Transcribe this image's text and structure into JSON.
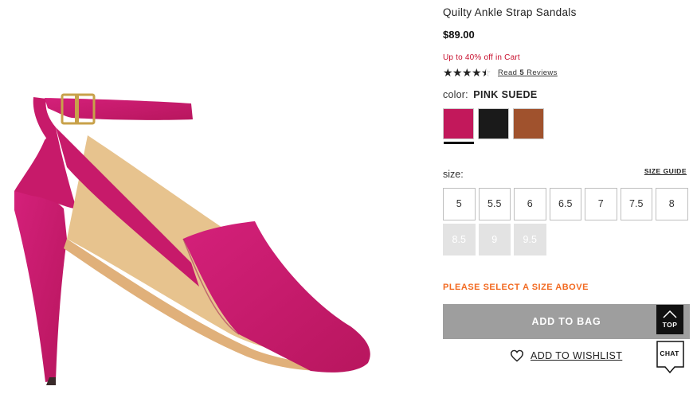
{
  "product": {
    "title": "Quilty Ankle Strap Sandals",
    "price": "$89.00",
    "promo": "Up to 40% off in Cart",
    "rating": 4.5,
    "reviews_prefix": "Read",
    "reviews_count": "5",
    "reviews_suffix": "Reviews",
    "image_alt": "pink suede ankle strap sandal"
  },
  "color": {
    "label": "color:",
    "selected": "PINK SUEDE",
    "swatches": [
      {
        "name": "pink-suede",
        "hex": "#c2185b",
        "selected": true
      },
      {
        "name": "black-suede",
        "hex": "#1a1a1a",
        "selected": false
      },
      {
        "name": "brown-suede",
        "hex": "#a0522d",
        "selected": false
      }
    ]
  },
  "size": {
    "label": "size:",
    "guide_label": "SIZE GUIDE",
    "options": [
      {
        "label": "5",
        "available": true
      },
      {
        "label": "5.5",
        "available": true
      },
      {
        "label": "6",
        "available": true
      },
      {
        "label": "6.5",
        "available": true
      },
      {
        "label": "7",
        "available": true
      },
      {
        "label": "7.5",
        "available": true
      },
      {
        "label": "8",
        "available": true
      },
      {
        "label": "8.5",
        "available": false
      },
      {
        "label": "9",
        "available": false
      },
      {
        "label": "9.5",
        "available": false
      }
    ],
    "warning": "PLEASE SELECT A SIZE ABOVE"
  },
  "actions": {
    "add_to_bag": "ADD TO BAG",
    "add_to_wishlist": "ADD TO WISHLIST",
    "top": "TOP",
    "chat": "CHAT"
  },
  "colors": {
    "promo_red": "#c8102e",
    "warning_orange": "#f26a21",
    "bag_button_gray": "#9e9e9e"
  }
}
